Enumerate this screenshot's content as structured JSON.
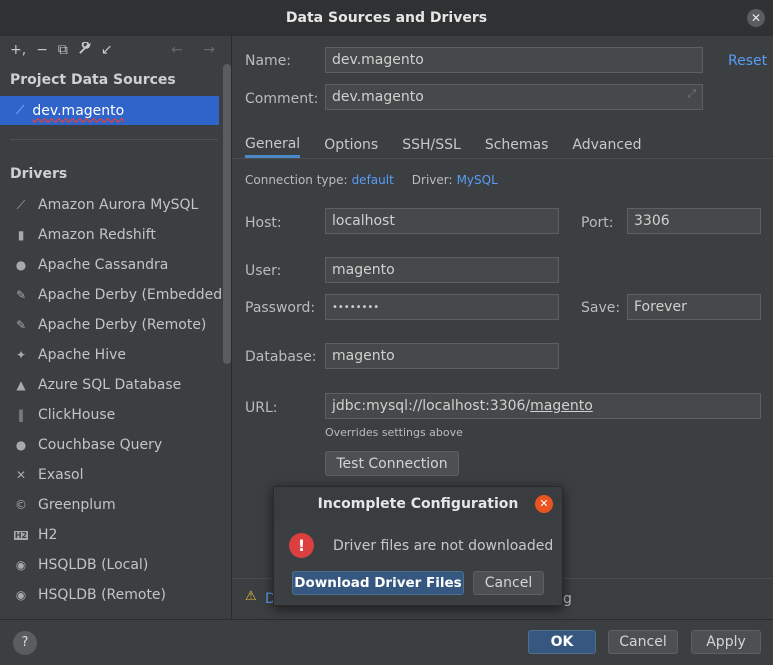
{
  "window": {
    "title": "Data Sources and Drivers",
    "close": "✕"
  },
  "sidebar": {
    "toolbar": [
      "+,",
      "−",
      "⧉",
      "🔧",
      "↙"
    ],
    "toolbar_nav": "← →",
    "project_title": "Project Data Sources",
    "data_source": "dev.magento",
    "drivers_title": "Drivers",
    "drivers": [
      {
        "label": "Amazon Aurora MySQL",
        "icon": "⟋"
      },
      {
        "label": "Amazon Redshift",
        "icon": "▮"
      },
      {
        "label": "Apache Cassandra",
        "icon": "●"
      },
      {
        "label": "Apache Derby (Embedded)",
        "icon": "✎"
      },
      {
        "label": "Apache Derby (Remote)",
        "icon": "✎"
      },
      {
        "label": "Apache Hive",
        "icon": "✦"
      },
      {
        "label": "Azure SQL Database",
        "icon": "▲"
      },
      {
        "label": "ClickHouse",
        "icon": "‖"
      },
      {
        "label": "Couchbase Query",
        "icon": "●"
      },
      {
        "label": "Exasol",
        "icon": "✕"
      },
      {
        "label": "Greenplum",
        "icon": "©"
      },
      {
        "label": "H2",
        "icon": "H2"
      },
      {
        "label": "HSQLDB (Local)",
        "icon": "◉"
      },
      {
        "label": "HSQLDB (Remote)",
        "icon": "◉"
      }
    ]
  },
  "form": {
    "name_label": "Name:",
    "name_value": "dev.magento",
    "reset": "Reset",
    "comment_label": "Comment:",
    "comment_value": "dev.magento",
    "tabs": [
      "General",
      "Options",
      "SSH/SSL",
      "Schemas",
      "Advanced"
    ],
    "conn_type_label": "Connection type:",
    "conn_type_value": "default",
    "driver_label": "Driver:",
    "driver_value": "MySQL",
    "host_label": "Host:",
    "host_value": "localhost",
    "port_label": "Port:",
    "port_value": "3306",
    "user_label": "User:",
    "user_value": "magento",
    "password_label": "Password:",
    "password_value": "••••••••",
    "save_label": "Save:",
    "save_value": "Forever",
    "database_label": "Database:",
    "database_value": "magento",
    "url_label": "URL:",
    "url_prefix": "jdbc:mysql://localhost:3306/",
    "url_db": "magento",
    "url_hint": "Overrides settings above",
    "test_connection": "Test Connection"
  },
  "warning": {
    "icon": "⚠",
    "text_visible": "D",
    "text_tail": "g"
  },
  "footer": {
    "help": "?",
    "ok": "OK",
    "cancel": "Cancel",
    "apply": "Apply"
  },
  "popup": {
    "title": "Incomplete Configuration",
    "close": "✕",
    "icon": "!",
    "message": "Driver files are not downloaded",
    "download": "Download Driver Files",
    "cancel": "Cancel"
  }
}
